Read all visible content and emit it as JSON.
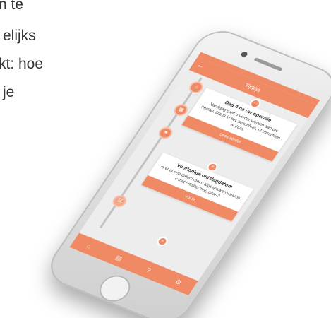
{
  "background_text": {
    "lines": [
      "n te",
      "elijks",
      "kt: hoe",
      "je"
    ]
  },
  "app": {
    "header_title": "Tijdlijn",
    "accent_color": "#ef8a64"
  },
  "cards": [
    {
      "title": "Dag 4 na uw operatie",
      "body": "Vandaag gaat u verder werken aan uw herstel. Dat is in het ziekenhuis, of misschien al thuis.",
      "button_label": "Lees verder"
    },
    {
      "title": "Voorlopige ontslagdatum",
      "body": "Is er al een datum met u afgesproken waarop u met ontslag mag gaan?",
      "button_label": "Vul in"
    }
  ],
  "timeline_icons": [
    "home-icon",
    "suitcase-icon",
    "star-icon",
    "calendar-icon"
  ],
  "tab_icons": [
    "home-icon",
    "book-icon",
    "question-icon",
    "settings-icon"
  ]
}
